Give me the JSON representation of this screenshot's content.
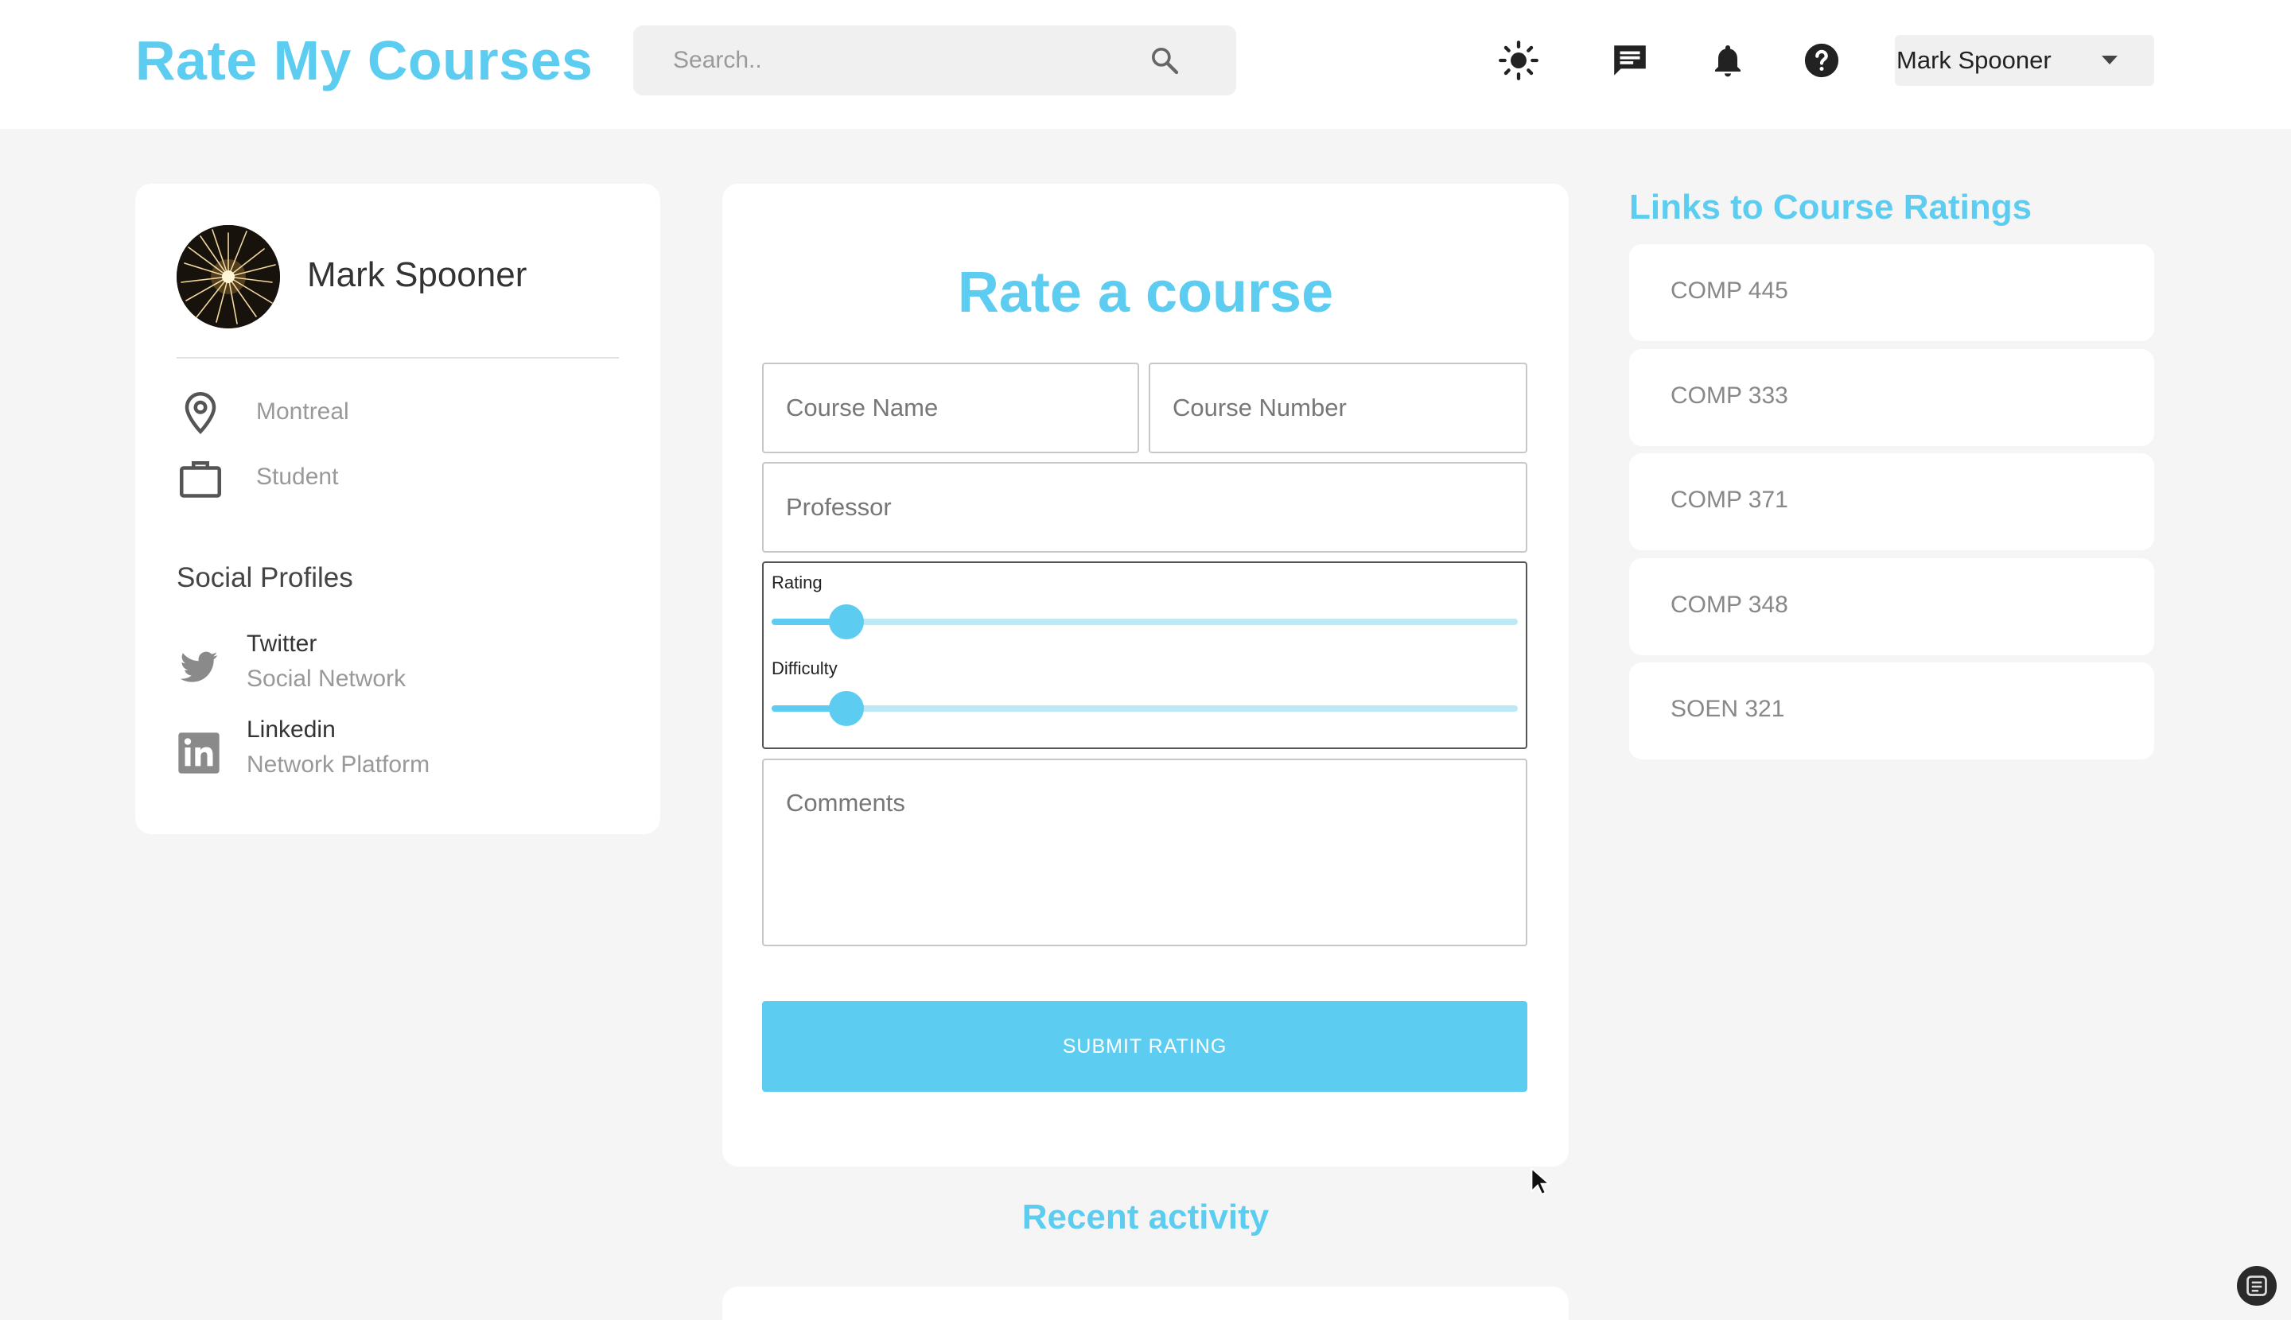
{
  "header": {
    "logo": "Rate My Courses",
    "search_placeholder": "Search..",
    "user_menu_label": "Mark Spooner"
  },
  "profile": {
    "name": "Mark Spooner",
    "location": "Montreal",
    "role": "Student",
    "social_title": "Social Profiles",
    "socials": [
      {
        "name": "Twitter",
        "sub": "Social Network"
      },
      {
        "name": "Linkedin",
        "sub": "Network Platform"
      }
    ]
  },
  "form": {
    "title": "Rate a course",
    "course_name_placeholder": "Course Name",
    "course_number_placeholder": "Course Number",
    "professor_placeholder": "Professor",
    "rating_label": "Rating",
    "rating_value": 0.1,
    "difficulty_label": "Difficulty",
    "difficulty_value": 0.1,
    "comments_placeholder": "Comments",
    "submit_label": "SUBMIT RATING"
  },
  "recent_title": "Recent activity",
  "links": {
    "title": "Links to Course Ratings",
    "items": [
      "COMP 445",
      "COMP 333",
      "COMP 371",
      "COMP 348",
      "SOEN 321"
    ]
  },
  "colors": {
    "accent": "#5ccdf0",
    "background": "#f5f5f5",
    "card": "#ffffff"
  }
}
